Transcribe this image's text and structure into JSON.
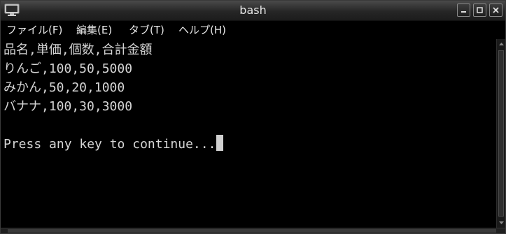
{
  "window": {
    "title": "bash",
    "icon": "terminal-monitor-icon",
    "controls": [
      "minimize-icon",
      "maximize-icon",
      "close-icon"
    ]
  },
  "menu": {
    "items": [
      {
        "label": "ファイル(F)"
      },
      {
        "label": "編集(E)"
      },
      {
        "label": "タブ(T)"
      },
      {
        "label": "ヘルプ(H)"
      }
    ]
  },
  "terminal": {
    "lines": [
      "品名,単価,個数,合計金額",
      "りんご,100,50,5000",
      "みかん,50,20,1000",
      "バナナ,100,30,3000",
      "",
      "Press any key to continue..."
    ],
    "text_color": "#d6d6d6",
    "background": "#000000"
  }
}
